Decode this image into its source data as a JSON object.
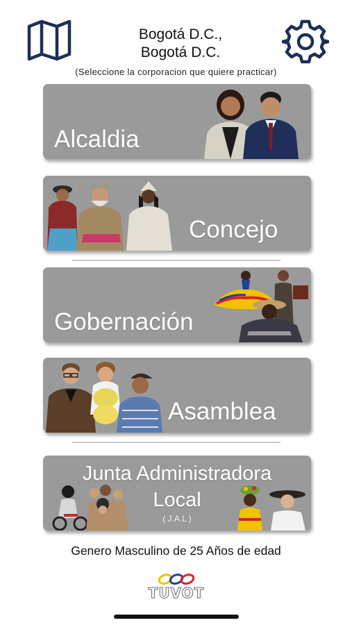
{
  "header": {
    "location_line1": "Bogotá D.C.,",
    "location_line2": "Bogotá D.C.",
    "instruction": "(Seleccione la corporacion que quiere practicar)",
    "left_icon": "map-icon",
    "right_icon": "gear-icon"
  },
  "cards": {
    "alcaldia": "Alcaldia",
    "concejo": "Concejo",
    "gobernacion": "Gobernación",
    "asamblea": "Asamblea",
    "jal_line1": "Junta Administradora",
    "jal_line2": "Local",
    "jal_abbrev": "( J.A.L )"
  },
  "footer": {
    "profile": "Genero Masculino de 25 Años de edad",
    "logo_text": "TUVOT"
  },
  "colors": {
    "card_bg": "#9a9a9a",
    "icon_navy": "#1b2f57",
    "logo_yellow": "#f2c200",
    "logo_blue": "#1f3f9a",
    "logo_red": "#d8232a"
  }
}
